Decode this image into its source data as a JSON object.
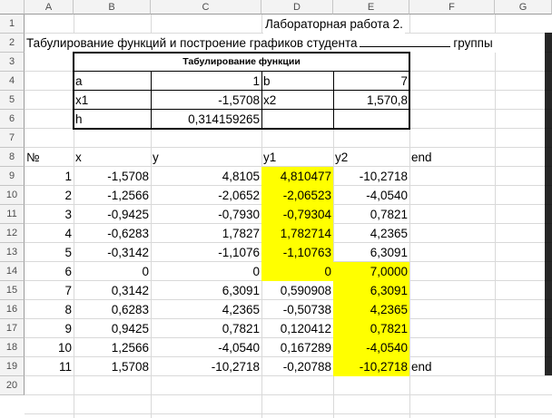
{
  "columns": [
    "A",
    "B",
    "C",
    "D",
    "E",
    "F",
    "G"
  ],
  "rows": [
    "1",
    "2",
    "3",
    "4",
    "5",
    "6",
    "7",
    "8",
    "9",
    "10",
    "11",
    "12",
    "13",
    "14",
    "15",
    "16",
    "17",
    "18",
    "19",
    "20"
  ],
  "title": "Лабораторная работа 2.",
  "subtitle": "Табулирование функций и построение графиков студента",
  "subtitle_suffix": "группы",
  "params_table": {
    "title": "Табулирование функции",
    "a_label": "a",
    "a_value": "1",
    "b_label": "b",
    "b_value": "7",
    "x1_label": "x1",
    "x1_value": "-1,5708",
    "x2_label": "x2",
    "x2_value": "1,570,8",
    "h_label": "h",
    "h_value": "0,314159265"
  },
  "data_headers": [
    "№",
    "x",
    "y",
    "y1",
    "y2",
    "end"
  ],
  "data_rows": [
    {
      "n": "1",
      "x": "-1,5708",
      "y": "4,8105",
      "y1": "4,810477",
      "y2": "-10,2718",
      "end": ""
    },
    {
      "n": "2",
      "x": "-1,2566",
      "y": "-2,0652",
      "y1": "-2,06523",
      "y2": "-4,0540",
      "end": ""
    },
    {
      "n": "3",
      "x": "-0,9425",
      "y": "-0,7930",
      "y1": "-0,79304",
      "y2": "0,7821",
      "end": ""
    },
    {
      "n": "4",
      "x": "-0,6283",
      "y": "1,7827",
      "y1": "1,782714",
      "y2": "4,2365",
      "end": ""
    },
    {
      "n": "5",
      "x": "-0,3142",
      "y": "-1,1076",
      "y1": "-1,10763",
      "y2": "6,3091",
      "end": ""
    },
    {
      "n": "6",
      "x": "0",
      "y": "0",
      "y1": "0",
      "y2": "7,0000",
      "end": ""
    },
    {
      "n": "7",
      "x": "0,3142",
      "y": "6,3091",
      "y1": "0,590908",
      "y2": "6,3091",
      "end": ""
    },
    {
      "n": "8",
      "x": "0,6283",
      "y": "4,2365",
      "y1": "-0,50738",
      "y2": "4,2365",
      "end": ""
    },
    {
      "n": "9",
      "x": "0,9425",
      "y": "0,7821",
      "y1": "0,120412",
      "y2": "0,7821",
      "end": ""
    },
    {
      "n": "10",
      "x": "1,2566",
      "y": "-4,0540",
      "y1": "0,167289",
      "y2": "-4,0540",
      "end": ""
    },
    {
      "n": "11",
      "x": "1,5708",
      "y": "-10,2718",
      "y1": "-0,20788",
      "y2": "-10,2718",
      "end": "end"
    }
  ],
  "highlight_color": "#ffff00"
}
